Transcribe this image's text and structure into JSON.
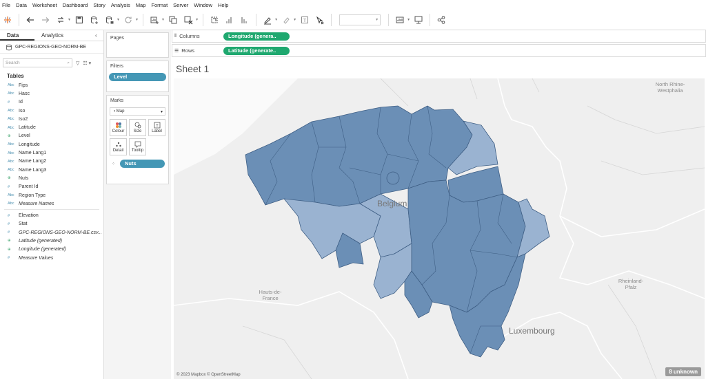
{
  "menu": [
    "File",
    "Data",
    "Worksheet",
    "Dashboard",
    "Story",
    "Analysis",
    "Map",
    "Format",
    "Server",
    "Window",
    "Help"
  ],
  "toolbar": {
    "icons": [
      "tableau-logo-icon",
      "undo-icon",
      "redo-icon",
      "replay-icon",
      "save-icon",
      "new-datasource-icon",
      "pause-updates-icon",
      "refresh-icon",
      "new-worksheet-icon",
      "duplicate-sheet-icon",
      "clear-sheet-icon",
      "swap-axes-icon",
      "sort-ascending-icon",
      "sort-descending-icon",
      "highlight-icon",
      "group-icon",
      "label-icon",
      "fix-axes-icon",
      "fit-dropdown",
      "show-me-icon",
      "presentation-icon",
      "share-icon"
    ]
  },
  "datapane": {
    "tab_data": "Data",
    "tab_analytics": "Analytics",
    "collapse": "‹",
    "datasource_name": "GPC-REGIONS-GEO-NORM-BE",
    "search_placeholder": "Search",
    "tables_header": "Tables",
    "fields": [
      {
        "type": "Abc",
        "name": "Fips",
        "italic": false
      },
      {
        "type": "Abc",
        "name": "Hasc",
        "italic": false
      },
      {
        "type": "#",
        "name": "Id",
        "italic": false
      },
      {
        "type": "Abc",
        "name": "Iso",
        "italic": false
      },
      {
        "type": "Abc",
        "name": "Iso2",
        "italic": false
      },
      {
        "type": "Abc",
        "name": "Latitude",
        "italic": false
      },
      {
        "type": "⊕",
        "name": "Level",
        "italic": false
      },
      {
        "type": "Abc",
        "name": "Longitude",
        "italic": false
      },
      {
        "type": "Abc",
        "name": "Name Lang1",
        "italic": false
      },
      {
        "type": "Abc",
        "name": "Name Lang2",
        "italic": false
      },
      {
        "type": "Abc",
        "name": "Name Lang3",
        "italic": false
      },
      {
        "type": "⊕",
        "name": "Nuts",
        "italic": false
      },
      {
        "type": "#",
        "name": "Parent Id",
        "italic": false
      },
      {
        "type": "Abc",
        "name": "Region Type",
        "italic": false
      },
      {
        "type": "Abc",
        "name": "Measure Names",
        "italic": true
      }
    ],
    "measures": [
      {
        "type": "#",
        "name": "Elevation",
        "italic": false
      },
      {
        "type": "#",
        "name": "Stat",
        "italic": false
      },
      {
        "type": "#",
        "name": "GPC-REGIONS-GEO-NORM-BE.csv...",
        "italic": true
      },
      {
        "type": "⊕",
        "name": "Latitude (generated)",
        "italic": true
      },
      {
        "type": "⊕",
        "name": "Longitude (generated)",
        "italic": true
      },
      {
        "type": "#",
        "name": "Measure Values",
        "italic": true
      }
    ]
  },
  "cards": {
    "pages_title": "Pages",
    "filters_title": "Filters",
    "filter_pill": "Level",
    "marks_title": "Marks",
    "mark_type": "Map",
    "mark_buttons": [
      {
        "label": "Colour",
        "icon": "colour-icon"
      },
      {
        "label": "Size",
        "icon": "size-icon"
      },
      {
        "label": "Label",
        "icon": "label-icon"
      },
      {
        "label": "Detail",
        "icon": "detail-icon"
      },
      {
        "label": "Tooltip",
        "icon": "tooltip-icon"
      }
    ],
    "detail_pill": "Nuts"
  },
  "shelves": {
    "columns_label": "Columns",
    "columns_pill": "Longitude (genera..",
    "rows_label": "Rows",
    "rows_pill": "Latitude (generate.."
  },
  "sheet": {
    "title": "Sheet 1",
    "map_labels": {
      "belgium": "Belgium",
      "luxembourg": "Luxembourg",
      "north_rhine": "North Rhine-\nWestphalia",
      "hauts_de_france": "Hauts-de-\nFrance",
      "rheinland": "Rheinland-\nPfalz"
    },
    "attribution": "© 2023 Mapbox © OpenStreetMap",
    "unknown_badge": "8 unknown",
    "colors": {
      "region_dark": "#6b8fb6",
      "region_light": "#9ab3d1",
      "border": "#3f5f85",
      "land": "#ececec"
    }
  }
}
